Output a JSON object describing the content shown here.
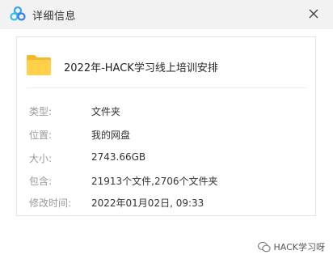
{
  "window": {
    "title": "详细信息",
    "logo_icon": "cloud-disk-logo-icon",
    "close_icon": "close-icon"
  },
  "file": {
    "icon": "folder-icon",
    "name": "2022年-HACK学习线上培训安排"
  },
  "details": [
    {
      "label": "类型:",
      "value": "文件夹"
    },
    {
      "label": "位置:",
      "value": "我的网盘"
    },
    {
      "label": "大小:",
      "value": "2743.66GB"
    },
    {
      "label": "包含:",
      "value": "21913个文件,2706个文件夹"
    },
    {
      "label": "修改时间:",
      "value": "2022年01月02日, 09:33"
    }
  ],
  "watermark": {
    "icon": "wechat-icon",
    "text": "HACK学习呀"
  },
  "colors": {
    "titlebar_bg": "#f2f2f3",
    "label_text": "#999999",
    "value_text": "#333333",
    "folder_yellow": "#ffd048"
  }
}
